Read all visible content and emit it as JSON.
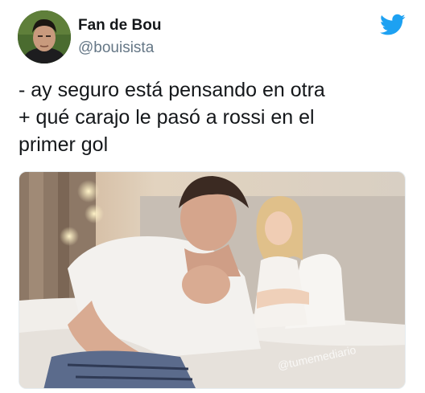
{
  "user": {
    "display_name": "Fan de Bou",
    "handle": "@bouisista",
    "avatar_icon": "profile-photo"
  },
  "tweet": {
    "lines": [
      "- ay seguro está pensando en otra",
      "+ qué carajo le pasó a rossi en el",
      "primer gol"
    ]
  },
  "media": {
    "description_icon": "photo-couple-in-bed",
    "watermark": "@tumemediario"
  },
  "brand": {
    "icon": "twitter-bird-icon",
    "color": "#1da1f2"
  }
}
